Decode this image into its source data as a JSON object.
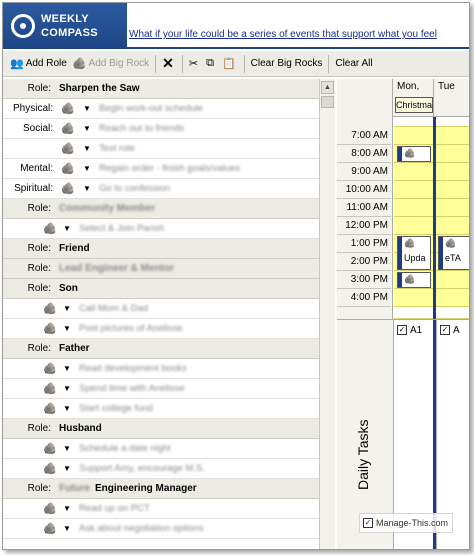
{
  "header": {
    "logo_line1": "WEEKLY",
    "logo_line2": "COMPASS",
    "tagline": "What if your life could be a series of events that support what you feel"
  },
  "toolbar": {
    "add_role": "Add Role",
    "add_big_rock": "Add Big Rock",
    "clear_big_rocks": "Clear Big Rocks",
    "clear_all": "Clear All"
  },
  "roles": {
    "role_prefix": "Role:",
    "r1": "Sharpen the Saw",
    "r2": "Community Member",
    "r3": "Friend",
    "r4": "Lead Engineer & Mentor",
    "r5": "Son",
    "r6": "Father",
    "r7": "Husband",
    "r8_blur": "Future",
    "r8": "Engineering Manager"
  },
  "categories": {
    "physical": "Physical:",
    "social": "Social:",
    "mental": "Mental:",
    "spiritual": "Spiritual:"
  },
  "goals": {
    "g1": "Begin work-out schedule",
    "g2": "Reach out to friends",
    "g3": "Text role",
    "g4": "Regain order - finish goals/values",
    "g5": "Go to confession",
    "g6": "Select & Join Parish",
    "g7": "Call Mom & Dad",
    "g8": "Post pictures of Anelisse",
    "g9": "Read development books",
    "g10": "Spend time with Anelisse",
    "g11": "Start college fund",
    "g12": "Schedule a date night",
    "g13": "Support Amy, encourage M.S.",
    "g14": "Read up on PCT",
    "g15": "Ask about negotiation options"
  },
  "calendar": {
    "day1": "Mon,",
    "day2": "Tue",
    "day1_event": "Christmas",
    "times": [
      "7:00 AM",
      "8:00 AM",
      "9:00 AM",
      "10:00 AM",
      "11:00 AM",
      "12:00 PM",
      "1:00 PM",
      "2:00 PM",
      "3:00 PM",
      "4:00 PM"
    ],
    "appt_a": "Upda",
    "appt_b": "eTA"
  },
  "tasks": {
    "title": "Daily Tasks",
    "col1": "A1",
    "col2": "A"
  },
  "watermark": "Manage-This.com"
}
